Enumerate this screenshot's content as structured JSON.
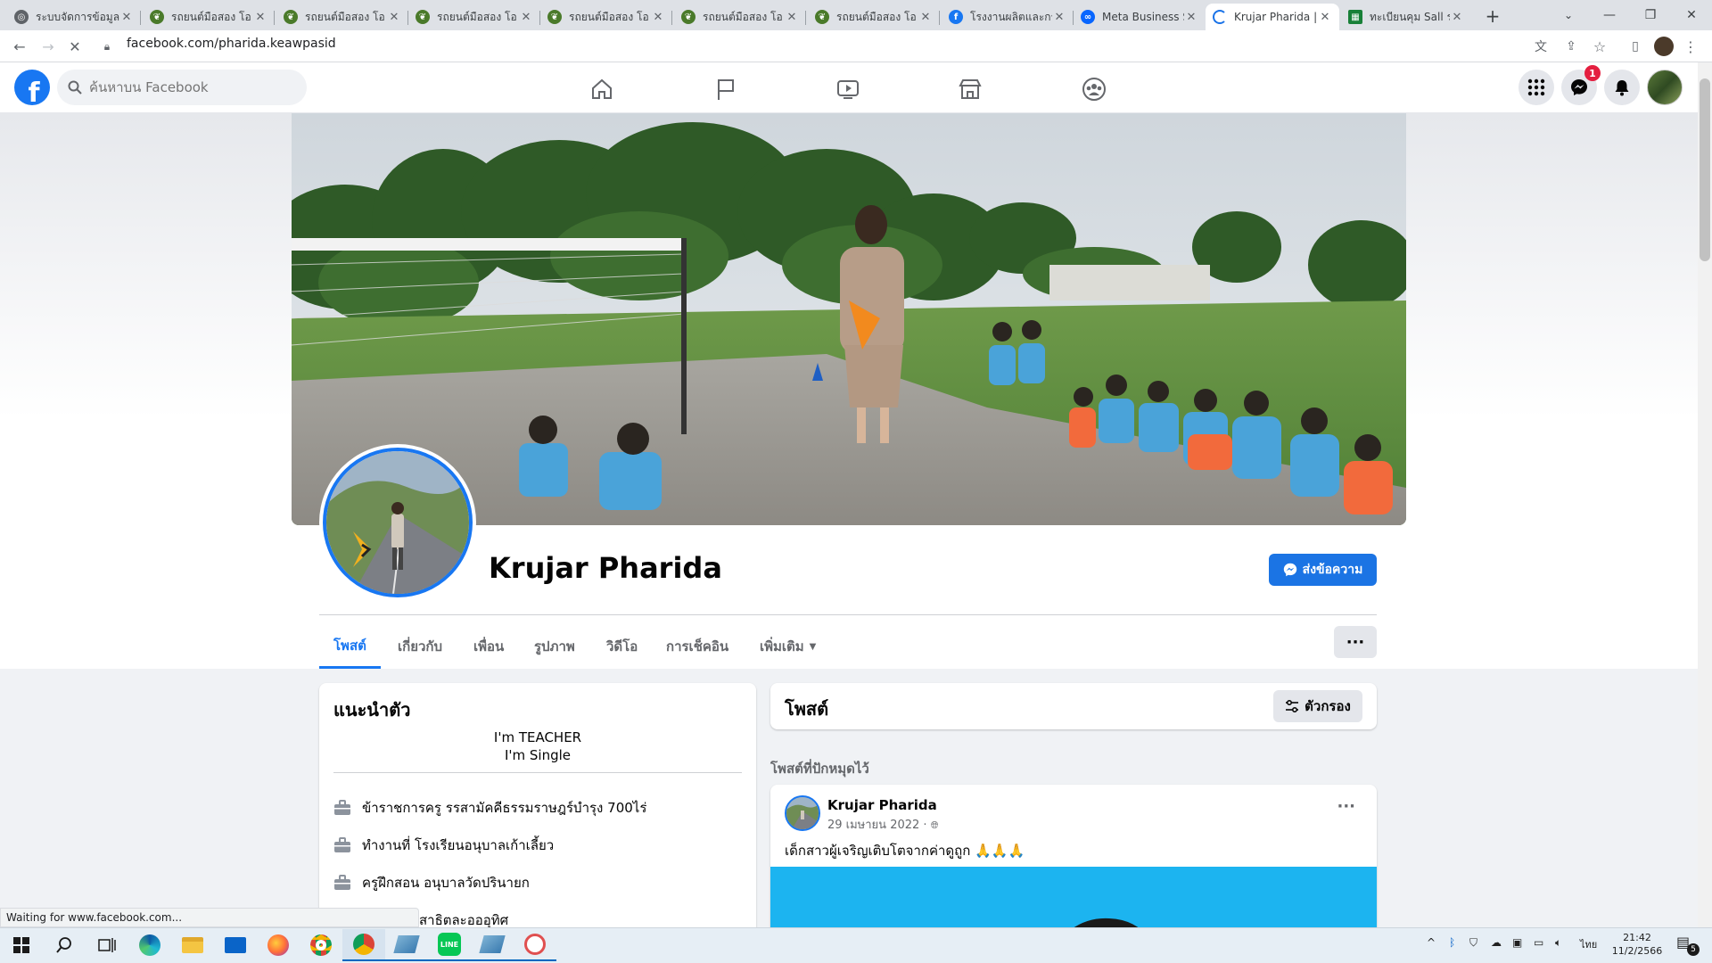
{
  "browser": {
    "tabs": [
      {
        "title": "ระบบจัดการข้อมูล",
        "favicon": "globe-icon",
        "color": "#5f6368",
        "active": false
      },
      {
        "title": "รถยนต์มือสอง โอ",
        "favicon": "leaf-icon",
        "color": "#4a7a2a",
        "active": false
      },
      {
        "title": "รถยนต์มือสอง โอ",
        "favicon": "leaf-icon",
        "color": "#4a7a2a",
        "active": false
      },
      {
        "title": "รถยนต์มือสอง โอ",
        "favicon": "leaf-icon",
        "color": "#4a7a2a",
        "active": false
      },
      {
        "title": "รถยนต์มือสอง โอ",
        "favicon": "leaf-icon",
        "color": "#4a7a2a",
        "active": false
      },
      {
        "title": "รถยนต์มือสอง โอ",
        "favicon": "leaf-icon",
        "color": "#4a7a2a",
        "active": false
      },
      {
        "title": "รถยนต์มือสอง โอ",
        "favicon": "leaf-icon",
        "color": "#4a7a2a",
        "active": false
      },
      {
        "title": "โรงงานผลิตและกร",
        "favicon": "facebook-icon",
        "color": "#1877f2",
        "active": false
      },
      {
        "title": "Meta Business S",
        "favicon": "meta-icon",
        "color": "#0866ff",
        "active": false
      },
      {
        "title": "Krujar Pharida |",
        "favicon": "loading-icon",
        "color": "#1a73e8",
        "active": true
      },
      {
        "title": "ทะเบียนคุม Sall ร",
        "favicon": "sheets-icon",
        "color": "#188038",
        "active": false
      }
    ],
    "new_tab": "+",
    "url": "facebook.com/pharida.keawpasid",
    "status_text": "Waiting for www.facebook.com..."
  },
  "facebook": {
    "search_placeholder": "ค้นหาบน Facebook",
    "messenger_badge": "1",
    "profile_name": "Krujar Pharida",
    "message_button": "ส่งข้อความ",
    "tabs": [
      "โพสต์",
      "เกี่ยวกับ",
      "เพื่อน",
      "รูปภาพ",
      "วิดีโอ",
      "การเช็คอิน",
      "เพิ่มเติม"
    ],
    "active_tab": "โพสต์",
    "more_dots": "···",
    "intro": {
      "title": "แนะนำตัว",
      "bio_line1": "I'm TEACHER",
      "bio_line2": "I'm Single",
      "items": [
        "ข้าราชการครู รรสามัคคีธรรมราษฎร์บำรุง 700ไร่",
        "ทำงานที่ โรงเรียนอนุบาลเก้าเลี้ยว",
        "ครูฝึกสอน อนุบาลวัดปรินายก",
        "สาธิตละอออุทิศ"
      ]
    },
    "posts_header": {
      "title": "โพสต์",
      "filter_label": "ตัวกรอง"
    },
    "pinned_label": "โพสต์ที่ปักหมุดไว้",
    "post": {
      "author": "Krujar Pharida",
      "date": "29 เมษายน 2022 ·",
      "text": "เด็กสาวผู้เจริญเติบโตจากค่าดูถูก 🙏🙏🙏",
      "image_color": "#1cb4f0"
    }
  },
  "taskbar": {
    "lang": "ไทย",
    "time": "21:42",
    "date": "11/2/2566",
    "notif_count": "5"
  },
  "colors": {
    "fb_blue": "#1877f2",
    "button_blue": "#1b74e4",
    "badge_red": "#e41e3f"
  }
}
